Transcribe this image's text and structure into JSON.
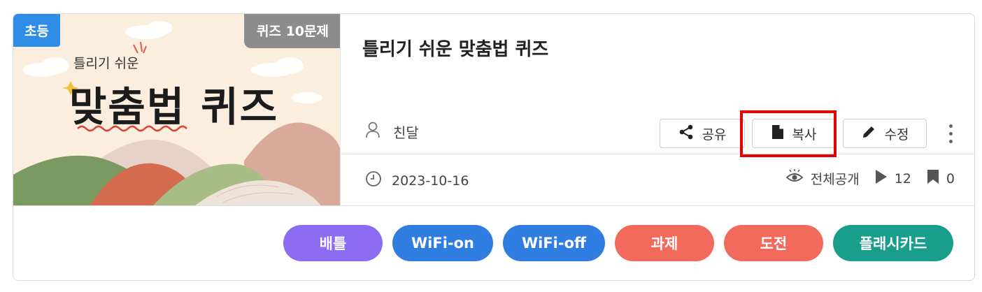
{
  "thumbnail": {
    "level_badge": "초등",
    "type_badge": "퀴즈 10문제",
    "subtitle": "틀리기 쉬운",
    "title": "맞춤법 퀴즈"
  },
  "quiz": {
    "title": "틀리기 쉬운 맞춤법 퀴즈",
    "author": "친달",
    "date": "2023-10-16",
    "visibility": "전체공개",
    "plays": "12",
    "bookmarks": "0"
  },
  "actions": {
    "share": "공유",
    "copy": "복사",
    "edit": "수정"
  },
  "modes": [
    {
      "label": "배틀",
      "color": "#8c6cf3"
    },
    {
      "label": "WiFi-on",
      "color": "#2f7de1"
    },
    {
      "label": "WiFi-off",
      "color": "#2f7de1"
    },
    {
      "label": "과제",
      "color": "#f26a5b"
    },
    {
      "label": "도전",
      "color": "#f26a5b"
    },
    {
      "label": "플래시카드",
      "color": "#1a9e8c"
    }
  ],
  "colors": {
    "highlight": "#e60000",
    "level_badge": "#2e8de6",
    "type_badge": "#8c8c8c"
  }
}
